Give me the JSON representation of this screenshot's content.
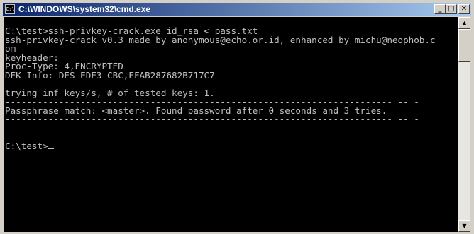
{
  "window": {
    "title": "C:\\WINDOWS\\system32\\cmd.exe",
    "icon_label": "C:\\",
    "buttons": {
      "minimize": "_",
      "maximize": "□",
      "close": "✕"
    }
  },
  "console": {
    "lines": [
      "C:\\test>ssh-privkey-crack.exe id_rsa < pass.txt",
      "ssh-privkey-crack v0.3 made by anonymous@echo.or.id, enhanced by michu@neophob.c",
      "om",
      "keyheader:",
      "Proc-Type: 4,ENCRYPTED",
      "DEK-Info: DES-EDE3-CBC,EFAB287682B717C7",
      "",
      "trying inf keys/s, # of tested keys: 1.",
      "------------------------------------------------------------------------ -- -",
      "Passphrase match: <master>. Found password after 0 seconds and 3 tries.",
      "------------------------------------------------------------------------ -- -",
      "",
      "",
      "C:\\test>"
    ]
  },
  "scrollbar": {
    "up_arrow": "▲",
    "down_arrow": "▼"
  }
}
